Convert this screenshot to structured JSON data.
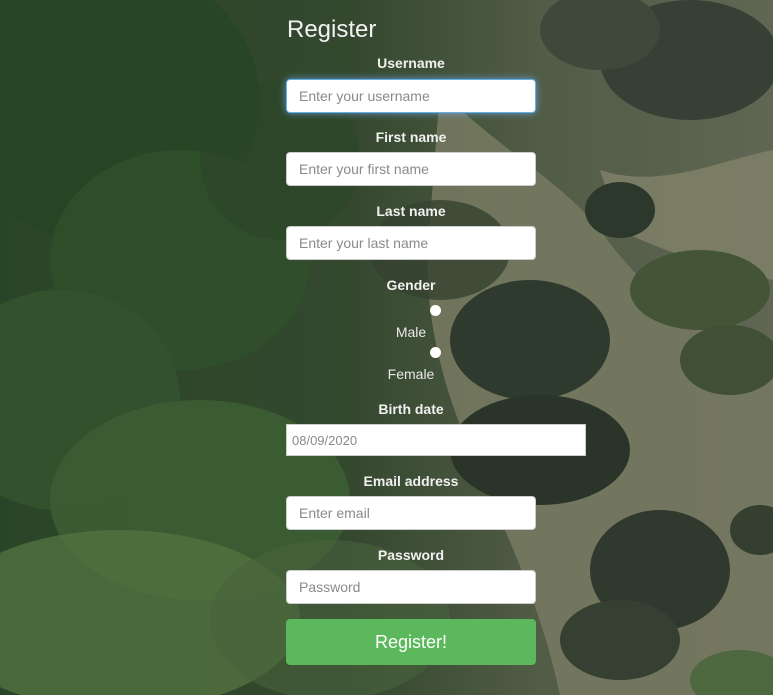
{
  "form": {
    "title": "Register",
    "username": {
      "label": "Username",
      "placeholder": "Enter your username"
    },
    "first_name": {
      "label": "First name",
      "placeholder": "Enter your first name"
    },
    "last_name": {
      "label": "Last name",
      "placeholder": "Enter your last name"
    },
    "gender": {
      "label": "Gender",
      "options": [
        "Male",
        "Female"
      ]
    },
    "birth_date": {
      "label": "Birth date",
      "placeholder": "08/09/2020"
    },
    "email": {
      "label": "Email address",
      "placeholder": "Enter email"
    },
    "password": {
      "label": "Password",
      "placeholder": "Password"
    },
    "submit_label": "Register!"
  },
  "colors": {
    "submit_button": "#5cb85c",
    "focus_ring": "#66afe9"
  }
}
